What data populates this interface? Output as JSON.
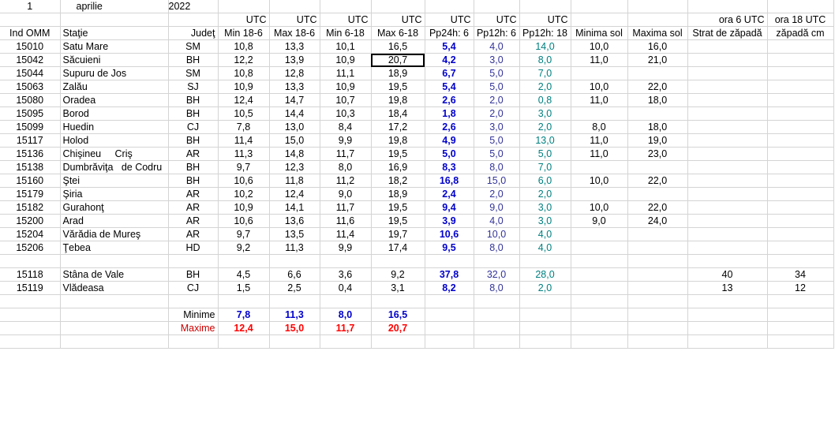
{
  "sheet": {
    "date_row": {
      "day": "1",
      "month": "aprilie",
      "year": "2022"
    },
    "utc_row": [
      "UTC",
      "UTC",
      "UTC",
      "UTC",
      "UTC",
      "UTC",
      "UTC"
    ],
    "utc_extra": {
      "ora6": "ora 6 UTC",
      "ora18": "ora 18 UTC"
    },
    "headers": [
      "Ind OMM",
      "Staţie",
      "Judeţ",
      "Min 18-6",
      "Max 18-6",
      "Min 6-18",
      "Max 6-18",
      "Pp24h: 6",
      "Pp12h: 6",
      "Pp12h: 18",
      "Minima sol",
      "Maxima sol",
      "Strat de zăpadă",
      "zăpadă cm"
    ],
    "stations": [
      {
        "id": "15010",
        "name": "Satu Mare",
        "county": "SM",
        "min186": "10,8",
        "max186": "13,3",
        "min618": "10,1",
        "max618": "16,5",
        "pp24": "5,4",
        "pp12a": "4,0",
        "pp12b": "14,0",
        "minsol": "10,0",
        "maxsol": "16,0"
      },
      {
        "id": "15042",
        "name": "Săcuieni",
        "county": "BH",
        "min186": "12,2",
        "max186": "13,9",
        "min618": "10,9",
        "max618": "20,7",
        "pp24": "4,2",
        "pp12a": "3,0",
        "pp12b": "8,0",
        "minsol": "11,0",
        "maxsol": "21,0"
      },
      {
        "id": "15044",
        "name": "Supuru de Jos",
        "county": "SM",
        "min186": "10,8",
        "max186": "12,8",
        "min618": "11,1",
        "max618": "18,9",
        "pp24": "6,7",
        "pp12a": "5,0",
        "pp12b": "7,0",
        "minsol": "",
        "maxsol": ""
      },
      {
        "id": "15063",
        "name": "Zalău",
        "county": "SJ",
        "min186": "10,9",
        "max186": "13,3",
        "min618": "10,9",
        "max618": "19,5",
        "pp24": "5,4",
        "pp12a": "5,0",
        "pp12b": "2,0",
        "minsol": "10,0",
        "maxsol": "22,0"
      },
      {
        "id": "15080",
        "name": "Oradea",
        "county": "BH",
        "min186": "12,4",
        "max186": "14,7",
        "min618": "10,7",
        "max618": "19,8",
        "pp24": "2,6",
        "pp12a": "2,0",
        "pp12b": "0,8",
        "minsol": "11,0",
        "maxsol": "18,0"
      },
      {
        "id": "15095",
        "name": "Borod",
        "county": "BH",
        "min186": "10,5",
        "max186": "14,4",
        "min618": "10,3",
        "max618": "18,4",
        "pp24": "1,8",
        "pp12a": "2,0",
        "pp12b": "3,0",
        "minsol": "",
        "maxsol": ""
      },
      {
        "id": "15099",
        "name": "Huedin",
        "county": "CJ",
        "min186": "7,8",
        "max186": "13,0",
        "min618": "8,4",
        "max618": "17,2",
        "pp24": "2,6",
        "pp12a": "3,0",
        "pp12b": "2,0",
        "minsol": "8,0",
        "maxsol": "18,0"
      },
      {
        "id": "15117",
        "name": "Holod",
        "county": "BH",
        "min186": "11,4",
        "max186": "15,0",
        "min618": "9,9",
        "max618": "19,8",
        "pp24": "4,9",
        "pp12a": "5,0",
        "pp12b": "13,0",
        "minsol": "11,0",
        "maxsol": "19,0"
      },
      {
        "id": "15136",
        "name": "Chişineu     Criş",
        "county": "AR",
        "min186": "11,3",
        "max186": "14,8",
        "min618": "11,7",
        "max618": "19,5",
        "pp24": "5,0",
        "pp12a": "5,0",
        "pp12b": "5,0",
        "minsol": "11,0",
        "maxsol": "23,0"
      },
      {
        "id": "15138",
        "name": "Dumbrăviţa   de Codru",
        "county": "BH",
        "min186": "9,7",
        "max186": "12,3",
        "min618": "8,0",
        "max618": "16,9",
        "pp24": "8,3",
        "pp12a": "8,0",
        "pp12b": "7,0",
        "minsol": "",
        "maxsol": ""
      },
      {
        "id": "15160",
        "name": "Ştei",
        "county": "BH",
        "min186": "10,6",
        "max186": "11,8",
        "min618": "11,2",
        "max618": "18,2",
        "pp24": "16,8",
        "pp12a": "15,0",
        "pp12b": "6,0",
        "minsol": "10,0",
        "maxsol": "22,0"
      },
      {
        "id": "15179",
        "name": "Şiria",
        "county": "AR",
        "min186": "10,2",
        "max186": "12,4",
        "min618": "9,0",
        "max618": "18,9",
        "pp24": "2,4",
        "pp12a": "2,0",
        "pp12b": "2,0",
        "minsol": "",
        "maxsol": ""
      },
      {
        "id": "15182",
        "name": "Gurahonţ",
        "county": "AR",
        "min186": "10,9",
        "max186": "14,1",
        "min618": "11,7",
        "max618": "19,5",
        "pp24": "9,4",
        "pp12a": "9,0",
        "pp12b": "3,0",
        "minsol": "10,0",
        "maxsol": "22,0"
      },
      {
        "id": "15200",
        "name": "Arad",
        "county": "AR",
        "min186": "10,6",
        "max186": "13,6",
        "min618": "11,6",
        "max618": "19,5",
        "pp24": "3,9",
        "pp12a": "4,0",
        "pp12b": "3,0",
        "minsol": "9,0",
        "maxsol": "24,0"
      },
      {
        "id": "15204",
        "name": "Vărădia de Mureş",
        "county": "AR",
        "min186": "9,7",
        "max186": "13,5",
        "min618": "11,4",
        "max618": "19,7",
        "pp24": "10,6",
        "pp12a": "10,0",
        "pp12b": "4,0",
        "minsol": "",
        "maxsol": ""
      },
      {
        "id": "15206",
        "name": "Ţebea",
        "county": "HD",
        "min186": "9,2",
        "max186": "11,3",
        "min618": "9,9",
        "max618": "17,4",
        "pp24": "9,5",
        "pp12a": "8,0",
        "pp12b": "4,0",
        "minsol": "",
        "maxsol": ""
      }
    ],
    "mountain": [
      {
        "id": "15118",
        "name": "Stâna de Vale",
        "county": "BH",
        "min186": "4,5",
        "max186": "6,6",
        "min618": "3,6",
        "max618": "9,2",
        "pp24": "37,8",
        "pp12a": "32,0",
        "pp12b": "28,0",
        "snow6": "40",
        "snow18": "34"
      },
      {
        "id": "15119",
        "name": "Vlădeasa",
        "county": "CJ",
        "min186": "1,5",
        "max186": "2,5",
        "min618": "0,4",
        "max618": "3,1",
        "pp24": "8,2",
        "pp12a": "8,0",
        "pp12b": "2,0",
        "snow6": "13",
        "snow18": "12"
      }
    ],
    "minime": {
      "label": "Minime",
      "values": [
        "7,8",
        "11,3",
        "8,0",
        "16,5"
      ]
    },
    "maxime": {
      "label": "Maxime",
      "values": [
        "12,4",
        "15,0",
        "11,7",
        "20,7"
      ]
    },
    "colors": {
      "blue": "#0000cc",
      "navy": "#333399",
      "teal": "#008080",
      "red": "#ff0000",
      "grid": "#d4d4d4"
    }
  }
}
